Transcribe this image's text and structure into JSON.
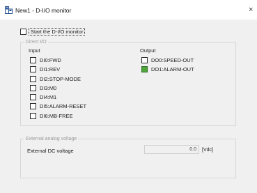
{
  "window": {
    "title": "New1 - D-I/O monitor",
    "close_glyph": "×",
    "app_icon": "io-monitor-app-icon"
  },
  "start_monitor": {
    "label": "Start the D-I/O monitor",
    "checked": false
  },
  "direct_io": {
    "legend": "Direct I/O",
    "input_heading": "Input",
    "output_heading": "Output",
    "inputs": [
      {
        "label": "DI0:FWD",
        "state": false
      },
      {
        "label": "DI1:REV",
        "state": false
      },
      {
        "label": "DI2:STOP-MODE",
        "state": false
      },
      {
        "label": "DI3:M0",
        "state": false
      },
      {
        "label": "DI4:M1",
        "state": false
      },
      {
        "label": "DI5:ALARM-RESET",
        "state": false
      },
      {
        "label": "DI6:MB-FREE",
        "state": false
      }
    ],
    "outputs": [
      {
        "label": "DO0:SPEED-OUT",
        "state": false
      },
      {
        "label": "DO1:ALARM-OUT",
        "state": true,
        "on_color": "#4fa53b"
      }
    ]
  },
  "analog": {
    "legend": "External analog voltage",
    "label": "External DC voltage",
    "value": "0.0",
    "unit": "[Vdc]"
  }
}
